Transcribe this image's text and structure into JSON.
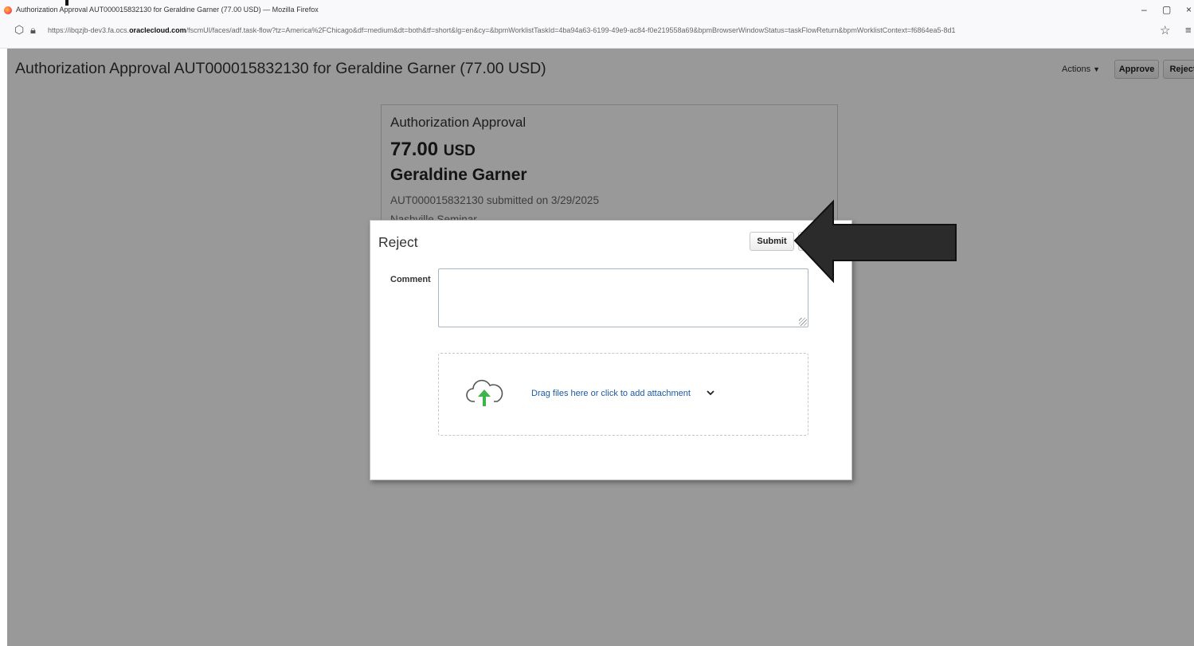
{
  "browser": {
    "window_title": "Authorization Approval AUT000015832130 for Geraldine Garner (77.00 USD) — Mozilla Firefox",
    "minimize": "–",
    "maximize": "▢",
    "close": "×",
    "url_prefix": "https://ibqzjb-dev3.fa.ocs.",
    "url_domain": "oraclecloud.com",
    "url_rest": "/fscmUI/faces/adf.task-flow?tz=America%2FChicago&df=medium&dt=both&tf=short&lg=en&cy=&bpmWorklistTaskId=4ba94a63-6199-49e9-ac84-f0e219558a69&bpmBrowserWindowStatus=taskFlowReturn&bpmWorklistContext=f6864ea5-8d1"
  },
  "header": {
    "title": "Authorization Approval AUT000015832130 for Geraldine Garner (77.00 USD)",
    "actions_label": "Actions",
    "approve_label": "Approve",
    "reject_label": "Reject"
  },
  "card": {
    "heading": "Authorization Approval",
    "amount": "77.00",
    "currency": "USD",
    "name": "Geraldine Garner",
    "submitted": "AUT000015832130 submitted on 3/29/2025",
    "event": "Nashville Seminar"
  },
  "dialog": {
    "title": "Reject",
    "submit_label": "Submit",
    "comment_label": "Comment",
    "comment_value": "",
    "dropzone_text": "Drag files here or click to add attachment"
  },
  "colors": {
    "link": "#1a5aa3",
    "upload_arrow": "#3cb54a",
    "annotation_arrow": "#2b2b2b"
  }
}
